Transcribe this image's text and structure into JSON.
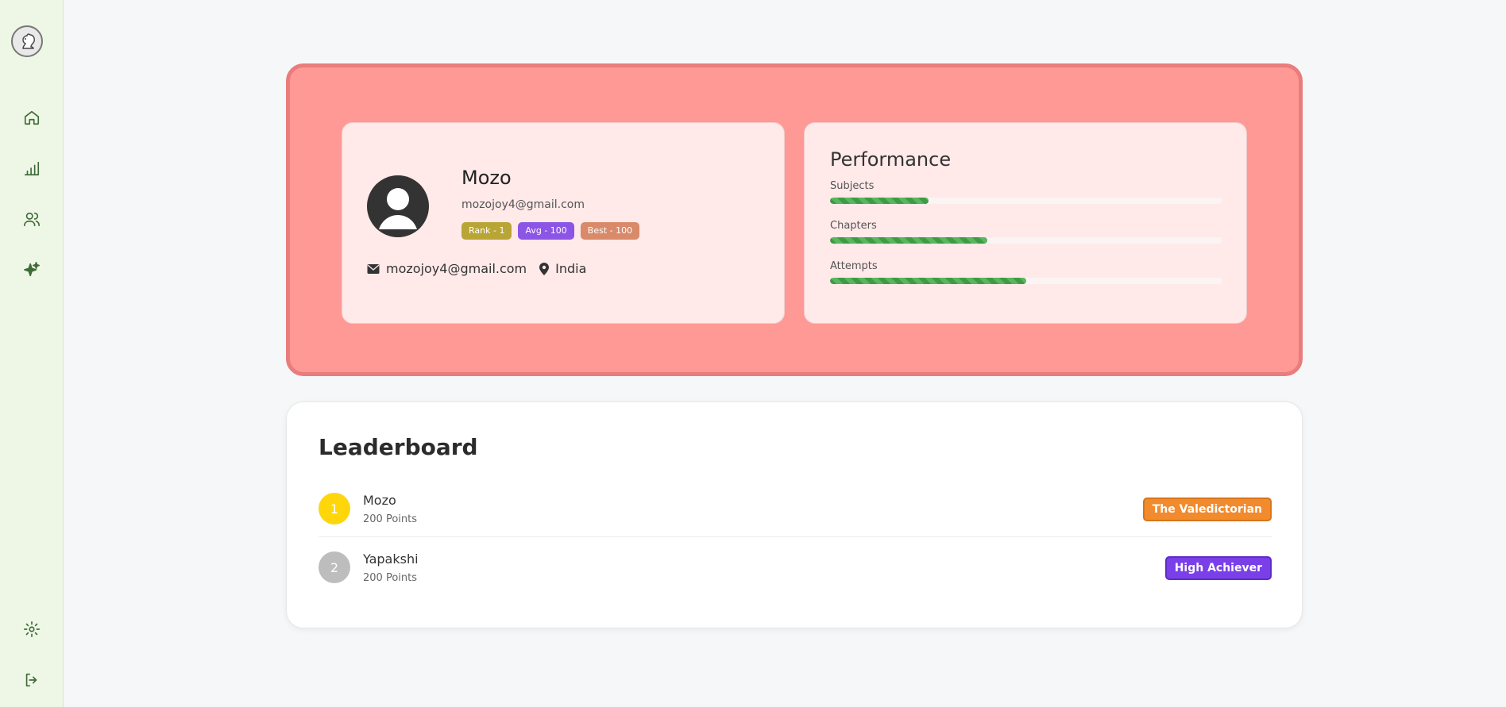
{
  "sidebar": {
    "logo": "squirrel-logo",
    "items": [
      {
        "name": "home",
        "icon": "home-icon"
      },
      {
        "name": "stats",
        "icon": "bar-chart-icon"
      },
      {
        "name": "users",
        "icon": "users-icon"
      },
      {
        "name": "sparkles",
        "icon": "sparkles-icon"
      }
    ],
    "bottom": [
      {
        "name": "settings",
        "icon": "gear-icon"
      },
      {
        "name": "logout",
        "icon": "logout-icon"
      }
    ]
  },
  "profile": {
    "name": "Mozo",
    "email": "mozojoy4@gmail.com",
    "badges": {
      "rank": "Rank - 1",
      "avg": "Avg - 100",
      "best": "Best - 100"
    },
    "contact_email": "mozojoy4@gmail.com",
    "location": "India"
  },
  "performance": {
    "title": "Performance",
    "metrics": [
      {
        "label": "Subjects",
        "progress": 0.25
      },
      {
        "label": "Chapters",
        "progress": 0.4
      },
      {
        "label": "Attempts",
        "progress": 0.5
      }
    ]
  },
  "leaderboard": {
    "title": "Leaderboard",
    "entries": [
      {
        "rank": "1",
        "name": "Mozo",
        "points": "200 Points",
        "tag": "The Valedictorian"
      },
      {
        "rank": "2",
        "name": "Yapakshi",
        "points": "200 Points",
        "tag": "High Achiever"
      }
    ]
  },
  "colors": {
    "hero_bg": "#fe9996",
    "rank_badge": "#b8a535",
    "avg_badge": "#8c55e6",
    "best_badge": "#d98a6a",
    "gold": "#ffd60a",
    "silver": "#bdbdbd",
    "valedictorian": "#f28a2e",
    "high_achiever": "#7a3fe8"
  }
}
